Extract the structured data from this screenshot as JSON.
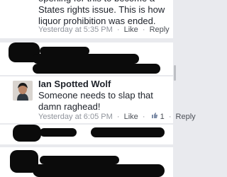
{
  "comment1": {
    "text": "opening for this to become a States rights issue. This is how liquor prohibition was ended.",
    "time": "Yesterday at 5:35 PM",
    "sep1": "·",
    "like": "Like",
    "sep2": "·",
    "reply": "Reply"
  },
  "comment2": {
    "author": "Ian Spotted Wolf",
    "text": "Someone needs to slap that damn raghead!",
    "time": "Yesterday at 6:05 PM",
    "sep1": "·",
    "like": "Like",
    "sep2": "·",
    "like_count": "1",
    "sep3": "·",
    "reply": "Reply"
  }
}
